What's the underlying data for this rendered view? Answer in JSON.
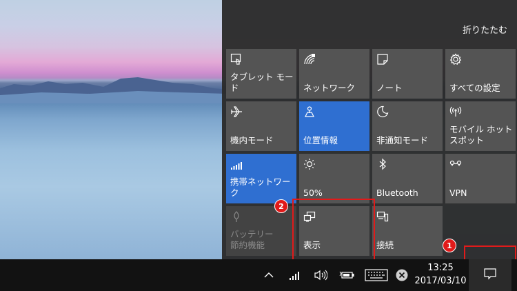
{
  "action_center": {
    "collapse_label": "折りたたむ",
    "tiles": [
      {
        "label": "タブレット モード",
        "icon": "tablet-mode-icon",
        "state": "normal"
      },
      {
        "label": "ネットワーク",
        "icon": "network-icon",
        "state": "normal"
      },
      {
        "label": "ノート",
        "icon": "note-icon",
        "state": "normal"
      },
      {
        "label": "すべての設定",
        "icon": "gear-icon",
        "state": "normal"
      },
      {
        "label": "機内モード",
        "icon": "airplane-icon",
        "state": "normal"
      },
      {
        "label": "位置情報",
        "icon": "location-icon",
        "state": "on"
      },
      {
        "label": "非通知モード",
        "icon": "moon-icon",
        "state": "normal"
      },
      {
        "label": "モバイル ホットスポット",
        "icon": "hotspot-icon",
        "state": "normal"
      },
      {
        "label": "携帯ネットワーク",
        "icon": "cellular-icon",
        "state": "on"
      },
      {
        "label": "50%",
        "icon": "brightness-icon",
        "state": "normal"
      },
      {
        "label": "Bluetooth",
        "icon": "bluetooth-icon",
        "state": "normal"
      },
      {
        "label": "VPN",
        "icon": "vpn-icon",
        "state": "normal"
      },
      {
        "label": "バッテリー\n節約機能",
        "icon": "battery-saver-icon",
        "state": "off"
      },
      {
        "label": "表示",
        "icon": "project-icon",
        "state": "normal"
      },
      {
        "label": "接続",
        "icon": "connect-icon",
        "state": "normal"
      }
    ]
  },
  "callouts": {
    "badge1": "1",
    "badge2": "2"
  },
  "taskbar": {
    "time": "13:25",
    "date": "2017/03/10"
  },
  "colors": {
    "tile_on": "#2f6fd1",
    "tile_normal": "#545454",
    "highlight": "#e11a1a"
  }
}
